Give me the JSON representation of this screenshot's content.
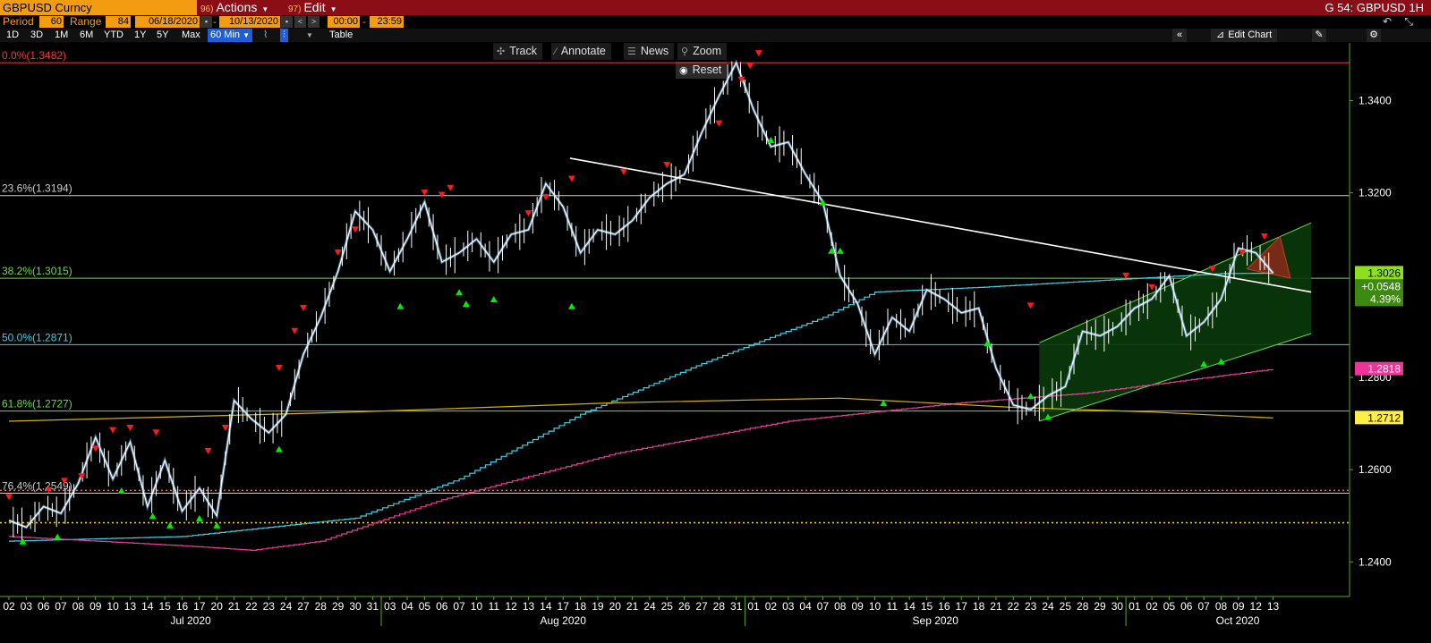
{
  "header": {
    "ticker": "GBPUSD Curncy",
    "actions_num": "96)",
    "actions_label": "Actions",
    "edit_num": "97)",
    "edit_label": "Edit",
    "right_title": "G 54: GBPUSD 1H"
  },
  "controls": {
    "period_label": "Period",
    "period_value": "60",
    "range_label": "Range",
    "range_value": "84",
    "start_date": "06/18/2020",
    "end_date": "10/13/2020",
    "start_time": "00:00",
    "end_time": "23:59"
  },
  "toolbar": {
    "ranges": [
      "1D",
      "3D",
      "1M",
      "6M",
      "YTD",
      "1Y",
      "5Y",
      "Max"
    ],
    "interval": "60 Min",
    "table": "Table",
    "edit_chart": "Edit Chart"
  },
  "chart_tools": {
    "track": "Track",
    "annotate": "Annotate",
    "news": "News",
    "zoom": "Zoom",
    "reset": "Reset"
  },
  "colors": {
    "background": "#000000",
    "price": "#ffffff",
    "price_body": "#7ec8ff",
    "sma_cyan": "#3fd0e8",
    "sma_magenta": "#e8409a",
    "sma_yellow": "#d4b000",
    "fib_red": "#ff3333",
    "fib_green": "#66dd44",
    "fib_cyan": "#40d0e0",
    "axis_green": "#5ea824",
    "sell_marker": "#ff1a1a",
    "buy_marker": "#00ee00"
  },
  "chart_data": {
    "type": "line",
    "title": "GBPUSD 1H",
    "ylim": [
      1.2325,
      1.3525
    ],
    "yticks": [
      1.24,
      1.26,
      1.28,
      1.32,
      1.34
    ],
    "ytick_labels": [
      "1.2400",
      "1.2600",
      "1.2800",
      "1.3200",
      "1.3400"
    ],
    "x_day_labels": [
      "02",
      "03",
      "06",
      "07",
      "08",
      "09",
      "10",
      "13",
      "14",
      "15",
      "16",
      "17",
      "20",
      "21",
      "22",
      "23",
      "24",
      "27",
      "28",
      "29",
      "30",
      "31",
      "03",
      "04",
      "05",
      "06",
      "07",
      "10",
      "11",
      "12",
      "13",
      "14",
      "17",
      "18",
      "19",
      "20",
      "21",
      "24",
      "25",
      "26",
      "27",
      "28",
      "31",
      "01",
      "02",
      "03",
      "04",
      "07",
      "08",
      "09",
      "10",
      "11",
      "14",
      "15",
      "16",
      "17",
      "18",
      "21",
      "22",
      "23",
      "24",
      "25",
      "28",
      "29",
      "30",
      "01",
      "02",
      "05",
      "06",
      "07",
      "08",
      "09",
      "12",
      "13"
    ],
    "month_labels": [
      {
        "label": "Jul 2020",
        "start_index": 0
      },
      {
        "label": "Aug 2020",
        "start_index": 22
      },
      {
        "label": "Sep 2020",
        "start_index": 43
      },
      {
        "label": "Oct 2020",
        "start_index": 65
      }
    ],
    "price_series": {
      "name": "GBPUSD",
      "points": [
        [
          0,
          1.249
        ],
        [
          1,
          1.2475
        ],
        [
          2,
          1.252
        ],
        [
          3,
          1.2505
        ],
        [
          4,
          1.257
        ],
        [
          5,
          1.267
        ],
        [
          6,
          1.258
        ],
        [
          7,
          1.266
        ],
        [
          8,
          1.252
        ],
        [
          9,
          1.262
        ],
        [
          10,
          1.251
        ],
        [
          11,
          1.256
        ],
        [
          12,
          1.25
        ],
        [
          13,
          1.275
        ],
        [
          14,
          1.271
        ],
        [
          15,
          1.268
        ],
        [
          16,
          1.272
        ],
        [
          17,
          1.285
        ],
        [
          18,
          1.293
        ],
        [
          19,
          1.303
        ],
        [
          20,
          1.316
        ],
        [
          21,
          1.312
        ],
        [
          22,
          1.303
        ],
        [
          23,
          1.31
        ],
        [
          24,
          1.318
        ],
        [
          25,
          1.305
        ],
        [
          26,
          1.307
        ],
        [
          27,
          1.31
        ],
        [
          28,
          1.305
        ],
        [
          29,
          1.311
        ],
        [
          30,
          1.312
        ],
        [
          31,
          1.322
        ],
        [
          32,
          1.317
        ],
        [
          33,
          1.307
        ],
        [
          34,
          1.312
        ],
        [
          35,
          1.311
        ],
        [
          36,
          1.314
        ],
        [
          37,
          1.319
        ],
        [
          38,
          1.322
        ],
        [
          39,
          1.324
        ],
        [
          40,
          1.333
        ],
        [
          41,
          1.341
        ],
        [
          42,
          1.3482
        ],
        [
          43,
          1.338
        ],
        [
          44,
          1.33
        ],
        [
          45,
          1.331
        ],
        [
          46,
          1.324
        ],
        [
          47,
          1.318
        ],
        [
          48,
          1.302
        ],
        [
          49,
          1.296
        ],
        [
          50,
          1.285
        ],
        [
          51,
          1.293
        ],
        [
          52,
          1.29
        ],
        [
          53,
          1.299
        ],
        [
          54,
          1.297
        ],
        [
          55,
          1.294
        ],
        [
          56,
          1.295
        ],
        [
          57,
          1.282
        ],
        [
          58,
          1.274
        ],
        [
          59,
          1.273
        ],
        [
          60,
          1.276
        ],
        [
          61,
          1.278
        ],
        [
          62,
          1.29
        ],
        [
          63,
          1.289
        ],
        [
          64,
          1.291
        ],
        [
          65,
          1.295
        ],
        [
          66,
          1.297
        ],
        [
          67,
          1.302
        ],
        [
          68,
          1.289
        ],
        [
          69,
          1.292
        ],
        [
          70,
          1.297
        ],
        [
          71,
          1.308
        ],
        [
          72,
          1.307
        ],
        [
          73,
          1.3026
        ]
      ]
    },
    "last_price": "1.3026",
    "change": "+0.0548",
    "change_pct": "4.39%",
    "fibonacci": [
      {
        "label": "0.0%(1.3482)",
        "value": 1.3482,
        "color": "#ff3333"
      },
      {
        "label": "23.6%(1.3194)",
        "value": 1.3194,
        "color": "#cccccc"
      },
      {
        "label": "38.2%(1.3015)",
        "value": 1.3015,
        "color": "#66dd44"
      },
      {
        "label": "50.0%(1.2871)",
        "value": 1.2871,
        "color": "#40d0e0"
      },
      {
        "label": "61.8%(1.2727)",
        "value": 1.2727,
        "color": "#66dd44"
      },
      {
        "label": "76.4%(1.2549)",
        "value": 1.2549,
        "color": "#cccccc"
      }
    ],
    "dotted_levels": [
      {
        "value": 1.2555,
        "color": "#e07060"
      },
      {
        "value": 1.2485,
        "color": "#ffdd00"
      }
    ],
    "moving_averages": [
      {
        "color": "#3fd0e8",
        "points": [
          [
            0,
            1.2445
          ],
          [
            10,
            1.2455
          ],
          [
            20,
            1.2495
          ],
          [
            26,
            1.258
          ],
          [
            33,
            1.272
          ],
          [
            40,
            1.283
          ],
          [
            47,
            1.293
          ],
          [
            50,
            1.2985
          ],
          [
            56,
            1.2995
          ],
          [
            63,
            1.301
          ],
          [
            70,
            1.3025
          ],
          [
            73,
            1.3026
          ]
        ],
        "stepped": true
      },
      {
        "color": "#e8409a",
        "points": [
          [
            0,
            1.2455
          ],
          [
            10,
            1.2435
          ],
          [
            14,
            1.2425
          ],
          [
            18,
            1.2445
          ],
          [
            25,
            1.2535
          ],
          [
            35,
            1.2635
          ],
          [
            45,
            1.2705
          ],
          [
            55,
            1.2745
          ],
          [
            62,
            1.2765
          ],
          [
            73,
            1.2818
          ]
        ],
        "stepped": true
      },
      {
        "color": "#d4b000",
        "points": [
          [
            0,
            1.2705
          ],
          [
            20,
            1.2725
          ],
          [
            35,
            1.2745
          ],
          [
            48,
            1.2755
          ],
          [
            58,
            1.2735
          ],
          [
            66,
            1.2725
          ],
          [
            73,
            1.2712
          ]
        ],
        "stepped": false
      }
    ],
    "trendline": {
      "color": "#ffffff",
      "points": [
        [
          32.4,
          1.3275
        ],
        [
          75.2,
          1.2985
        ]
      ]
    },
    "channel": {
      "lower": [
        [
          59.5,
          1.2705
        ],
        [
          75.2,
          1.2895
        ]
      ],
      "upper": [
        [
          59.5,
          1.2875
        ],
        [
          75.2,
          1.3135
        ]
      ],
      "fill": "#0a3a0a",
      "edge": "#66dd44"
    },
    "wedge": {
      "points": [
        [
          71.5,
          1.3035
        ],
        [
          73.4,
          1.3105
        ],
        [
          74,
          1.3015
        ]
      ],
      "fill": "#8b2a1a"
    },
    "right_axis_tags": [
      {
        "label": "1.3026",
        "value": 1.3026,
        "bg": "#8de020",
        "fg": "#000"
      },
      {
        "label": "1.2818",
        "value": 1.2818,
        "bg": "#ee3399",
        "fg": "#fff"
      },
      {
        "label": "1.2712",
        "value": 1.2712,
        "bg": "#ffee44",
        "fg": "#000"
      }
    ],
    "sell_signals": [
      [
        0,
        1.252
      ],
      [
        2.3,
        1.2535
      ],
      [
        3.2,
        1.2555
      ],
      [
        4.2,
        1.2565
      ],
      [
        5,
        1.2625
      ],
      [
        6,
        1.2665
      ],
      [
        7,
        1.267
      ],
      [
        8.5,
        1.266
      ],
      [
        11.5,
        1.262
      ],
      [
        12.5,
        1.267
      ],
      [
        15.6,
        1.28
      ],
      [
        16.5,
        1.288
      ],
      [
        17,
        1.293
      ],
      [
        19,
        1.305
      ],
      [
        20,
        1.31
      ],
      [
        24,
        1.318
      ],
      [
        25,
        1.3175
      ],
      [
        25.5,
        1.319
      ],
      [
        30,
        1.3135
      ],
      [
        31,
        1.317
      ],
      [
        32.5,
        1.321
      ],
      [
        35.5,
        1.3225
      ],
      [
        38,
        1.324
      ],
      [
        41,
        1.333
      ],
      [
        42.3,
        1.3425
      ],
      [
        42.8,
        1.3455
      ],
      [
        43.3,
        1.3482
      ],
      [
        59,
        1.2935
      ],
      [
        64.5,
        1.3
      ],
      [
        66,
        1.2975
      ],
      [
        69.5,
        1.3015
      ],
      [
        71.2,
        1.305
      ],
      [
        72.5,
        1.3085
      ]
    ],
    "buy_signals": [
      [
        0.8,
        1.2465
      ],
      [
        2.8,
        1.2475
      ],
      [
        6.5,
        1.2575
      ],
      [
        8.3,
        1.252
      ],
      [
        9.3,
        1.25
      ],
      [
        11,
        1.2515
      ],
      [
        12,
        1.25
      ],
      [
        15.6,
        1.2665
      ],
      [
        22.6,
        1.2975
      ],
      [
        26,
        1.3005
      ],
      [
        26.4,
        1.298
      ],
      [
        28,
        1.299
      ],
      [
        32.5,
        1.2975
      ],
      [
        44,
        1.3335
      ],
      [
        47,
        1.32
      ],
      [
        47.5,
        1.3095
      ],
      [
        48,
        1.3095
      ],
      [
        50.5,
        1.2765
      ],
      [
        56.5,
        1.2895
      ],
      [
        59,
        1.278
      ],
      [
        60,
        1.2735
      ],
      [
        69,
        1.285
      ],
      [
        70,
        1.2855
      ]
    ]
  }
}
